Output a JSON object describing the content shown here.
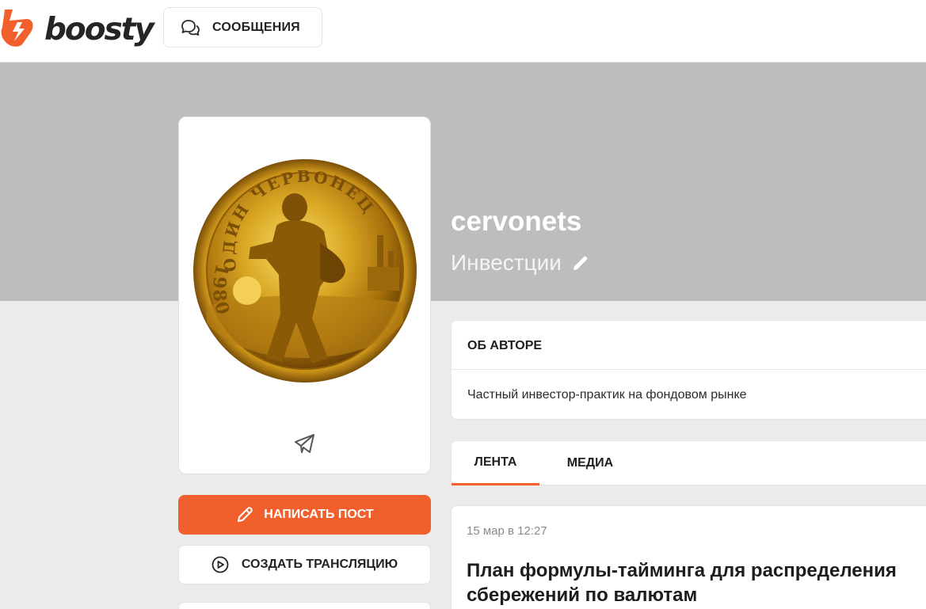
{
  "header": {
    "brand": "boosty",
    "messages_label": "СООБЩЕНИЯ"
  },
  "creator": {
    "name": "cervonets",
    "category": "Инвестции"
  },
  "avatar": {
    "coin_top_text": "ОДИН ЧЕРВОНЕЦ",
    "coin_year": "1980"
  },
  "actions": {
    "write_post": "НАПИСАТЬ ПОСТ",
    "create_stream": "СОЗДАТЬ ТРАНСЛЯЦИЮ"
  },
  "about": {
    "title": "ОБ АВТОРЕ",
    "text": "Частный инвестор-практик на фондовом рынке"
  },
  "tabs": [
    {
      "label": "ЛЕНТА",
      "active": true
    },
    {
      "label": "МЕДИА",
      "active": false
    }
  ],
  "post": {
    "date": "15 мар в 12:27",
    "title": "План формулы-тайминга для распределения сбережений по валютам"
  },
  "colors": {
    "accent": "#f15f2c",
    "cover": "#bdbdbd",
    "background": "#ebebeb"
  }
}
